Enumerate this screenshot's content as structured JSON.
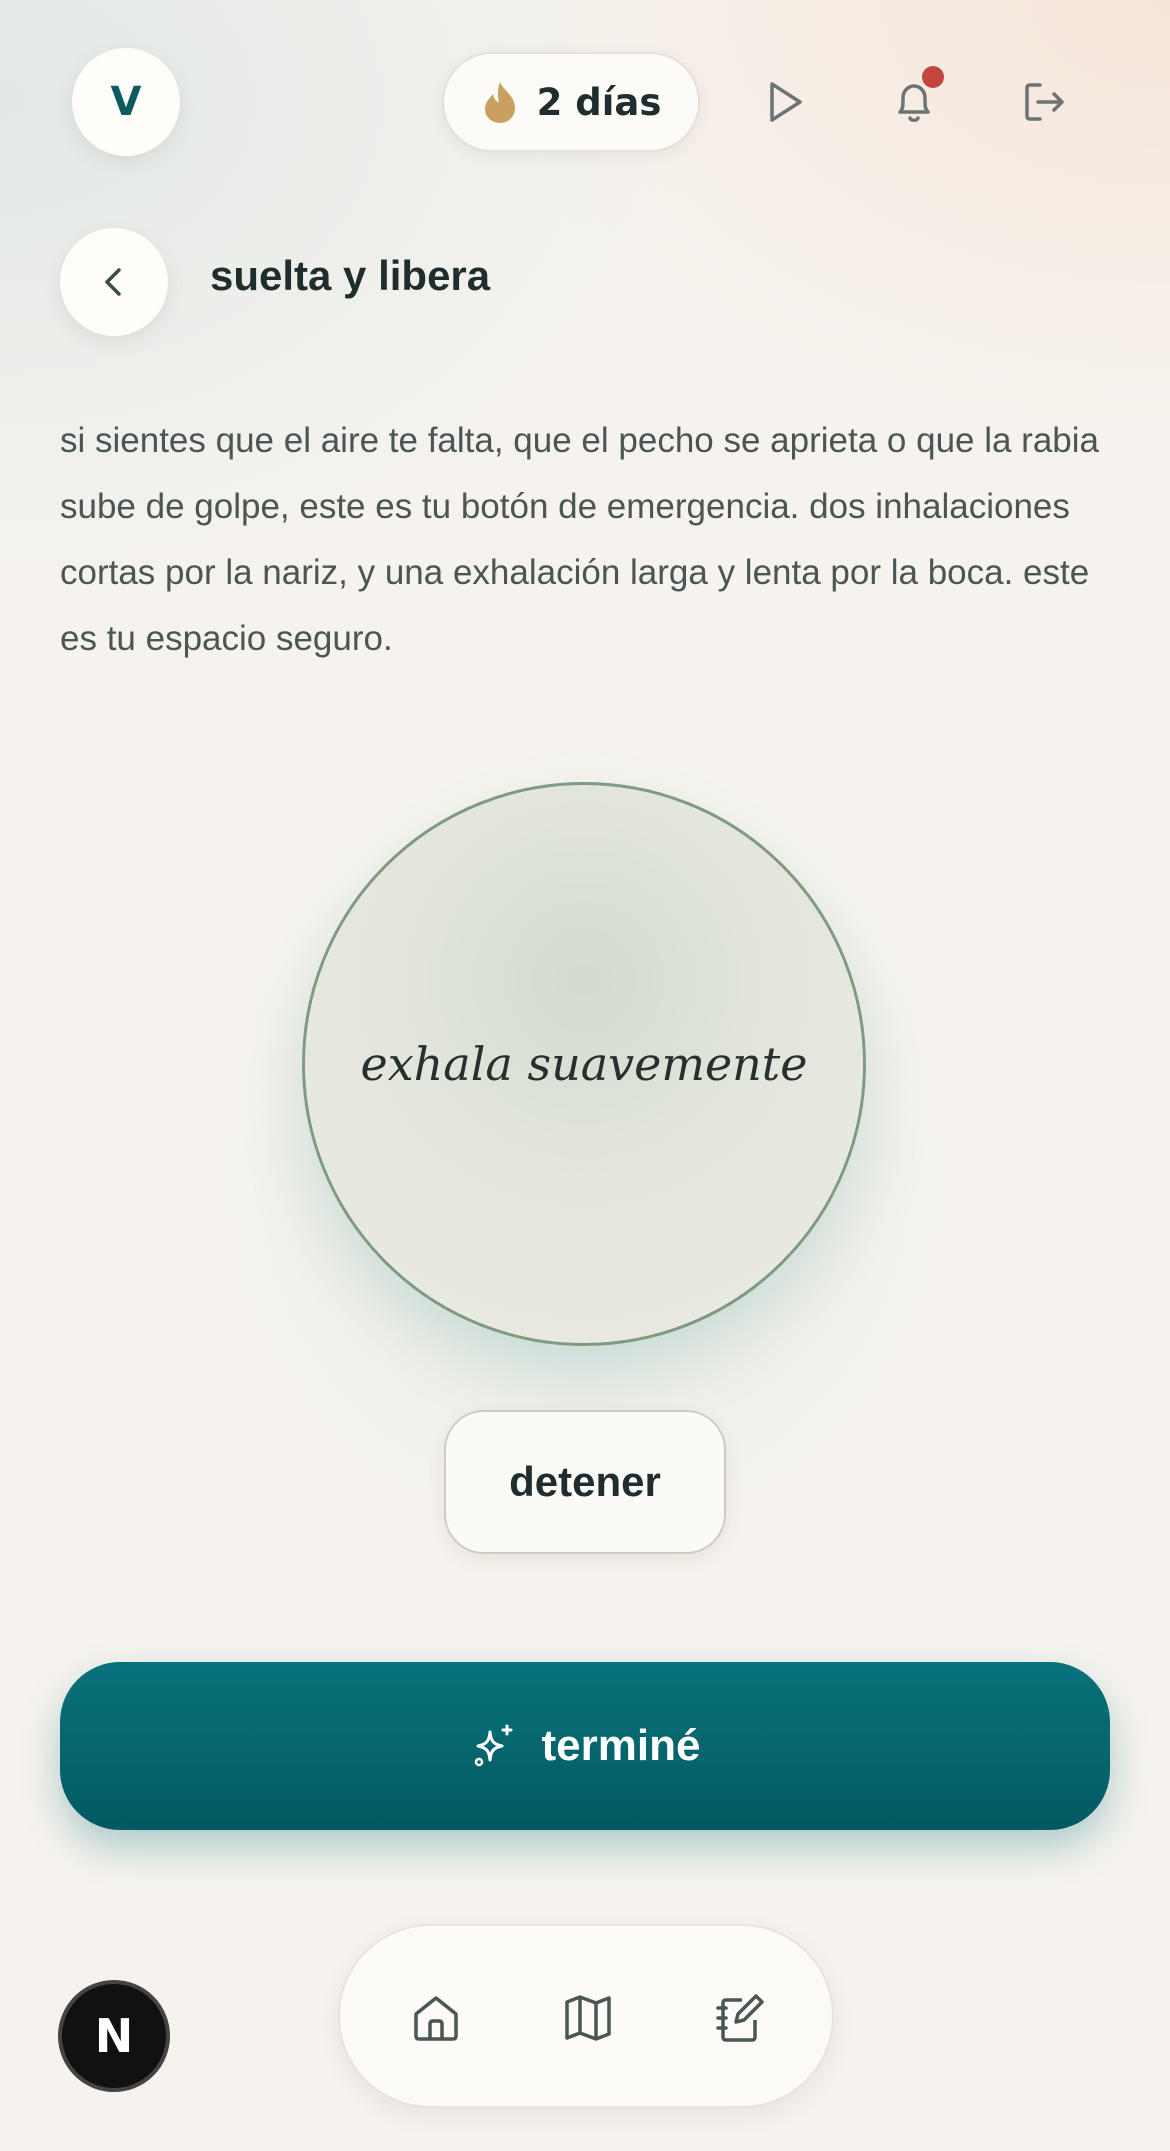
{
  "header": {
    "avatar_initial": "V",
    "streak_label": "2 días",
    "icons": [
      "flame-icon",
      "play-icon",
      "bell-icon",
      "logout-icon"
    ]
  },
  "page": {
    "title": "suelta y libera",
    "description": "si sientes que el aire te falta, que el pecho se aprieta o que la rabia sube de golpe, este es tu botón de emergencia. dos inhalaciones cortas por la nariz, y una exhalación larga y lenta por la boca. este es tu espacio seguro."
  },
  "breathing": {
    "instruction": "exhala suavemente",
    "stop_label": "detener"
  },
  "actions": {
    "done_label": "terminé"
  },
  "bottom_nav": {
    "items": [
      "home-icon",
      "map-icon",
      "journal-icon"
    ]
  },
  "dev_badge": "N",
  "colors": {
    "accent": "#08727a",
    "flame": "#c9a060",
    "notification": "#c2463e",
    "background": "#f6f3ee"
  }
}
